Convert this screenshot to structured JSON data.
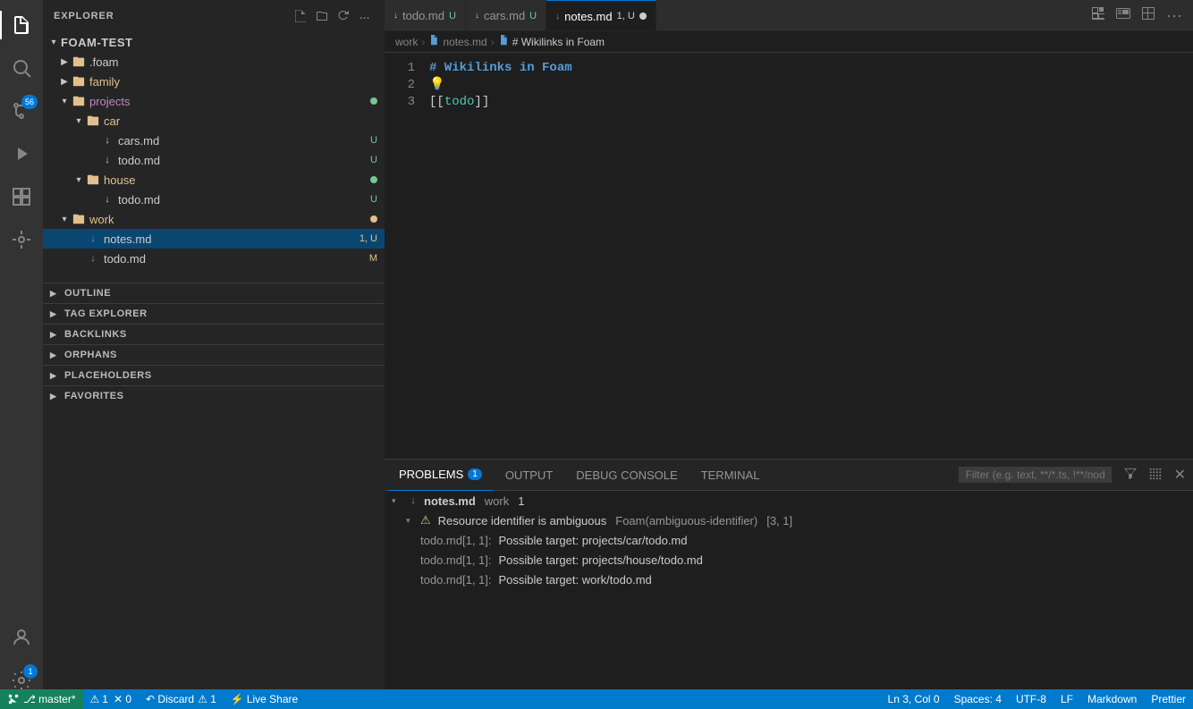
{
  "app": {
    "title": "EXPLORER"
  },
  "activity_bar": {
    "icons": [
      {
        "name": "files-icon",
        "label": "Explorer",
        "symbol": "⎘",
        "active": true,
        "badge": null
      },
      {
        "name": "search-icon",
        "label": "Search",
        "symbol": "🔍",
        "active": false,
        "badge": null
      },
      {
        "name": "source-control-icon",
        "label": "Source Control",
        "symbol": "⎇",
        "active": false,
        "badge": "56"
      },
      {
        "name": "run-icon",
        "label": "Run",
        "symbol": "▶",
        "active": false,
        "badge": null
      },
      {
        "name": "extensions-icon",
        "label": "Extensions",
        "symbol": "⧉",
        "active": false,
        "badge": null
      },
      {
        "name": "foam-icon",
        "label": "Foam",
        "symbol": "◈",
        "active": false,
        "badge": null
      }
    ],
    "bottom_icons": [
      {
        "name": "account-icon",
        "label": "Account",
        "symbol": "👤"
      },
      {
        "name": "settings-icon",
        "label": "Settings",
        "symbol": "⚙",
        "badge": "1"
      }
    ]
  },
  "sidebar": {
    "title": "EXPLORER",
    "root": "FOAM-TEST",
    "tree": [
      {
        "id": "foam-folder",
        "indent": 0,
        "type": "folder",
        "expanded": false,
        "name": ".foam",
        "badge": null,
        "dot": null
      },
      {
        "id": "family-folder",
        "indent": 0,
        "type": "folder",
        "expanded": false,
        "name": "family",
        "badge": null,
        "dot": null
      },
      {
        "id": "projects-folder",
        "indent": 0,
        "type": "folder",
        "expanded": true,
        "name": "projects",
        "badge": null,
        "dot": "green"
      },
      {
        "id": "car-folder",
        "indent": 1,
        "type": "folder",
        "expanded": true,
        "name": "car",
        "badge": null,
        "dot": null
      },
      {
        "id": "cars-md",
        "indent": 2,
        "type": "file",
        "expanded": false,
        "name": "cars.md",
        "badge": "U",
        "dot": null
      },
      {
        "id": "car-todo-md",
        "indent": 2,
        "type": "file",
        "expanded": false,
        "name": "todo.md",
        "badge": "U",
        "dot": null
      },
      {
        "id": "house-folder",
        "indent": 1,
        "type": "folder",
        "expanded": true,
        "name": "house",
        "badge": null,
        "dot": "green"
      },
      {
        "id": "house-todo-md",
        "indent": 2,
        "type": "file",
        "expanded": false,
        "name": "todo.md",
        "badge": "U",
        "dot": null
      },
      {
        "id": "work-folder",
        "indent": 0,
        "type": "folder",
        "expanded": true,
        "name": "work",
        "badge": null,
        "dot": "yellow"
      },
      {
        "id": "notes-md",
        "indent": 1,
        "type": "file",
        "expanded": false,
        "name": "notes.md",
        "badge": "1, U",
        "dot": null,
        "selected": true
      },
      {
        "id": "work-todo-md",
        "indent": 1,
        "type": "file",
        "expanded": false,
        "name": "todo.md",
        "badge": "M",
        "dot": null
      }
    ],
    "sections": [
      {
        "id": "outline",
        "label": "OUTLINE",
        "expanded": false
      },
      {
        "id": "tag-explorer",
        "label": "TAG EXPLORER",
        "expanded": false
      },
      {
        "id": "backlinks",
        "label": "BACKLINKS",
        "expanded": false
      },
      {
        "id": "orphans",
        "label": "ORPHANS",
        "expanded": false
      },
      {
        "id": "placeholders",
        "label": "PLACEHOLDERS",
        "expanded": false
      },
      {
        "id": "favorites",
        "label": "FAVORITES",
        "expanded": false
      }
    ]
  },
  "tabs": [
    {
      "id": "todo-tab",
      "name": "todo.md",
      "badge": "U",
      "active": false,
      "modified": false,
      "color": "#e2c08d"
    },
    {
      "id": "cars-tab",
      "name": "cars.md",
      "badge": "U",
      "active": false,
      "modified": false,
      "color": "#e2c08d"
    },
    {
      "id": "notes-tab",
      "name": "notes.md",
      "badge": "1, U",
      "active": true,
      "modified": true,
      "color": "#569cd6"
    }
  ],
  "breadcrumb": {
    "parts": [
      "work",
      "notes.md",
      "# Wikilinks in Foam"
    ]
  },
  "editor": {
    "lines": [
      {
        "number": "1",
        "content_type": "h1",
        "text": "# Wikilinks in Foam"
      },
      {
        "number": "2",
        "content_type": "bulb",
        "text": "💡"
      },
      {
        "number": "3",
        "content_type": "wikilink",
        "text": "[[todo]]"
      }
    ]
  },
  "panel": {
    "tabs": [
      {
        "id": "problems-tab",
        "label": "PROBLEMS",
        "count": "1",
        "active": true
      },
      {
        "id": "output-tab",
        "label": "OUTPUT",
        "count": null,
        "active": false
      },
      {
        "id": "debug-console-tab",
        "label": "DEBUG CONSOLE",
        "count": null,
        "active": false
      },
      {
        "id": "terminal-tab",
        "label": "TERMINAL",
        "count": null,
        "active": false
      }
    ],
    "filter_placeholder": "Filter (e.g. text, **/*.ts, !**/node_modules/**)",
    "entries": [
      {
        "id": "notes-entry",
        "file": "notes.md",
        "context": "work",
        "count": "1",
        "expanded": true,
        "children": [
          {
            "id": "warning-entry",
            "type": "warning",
            "message": "Resource identifier is ambiguous",
            "source": "Foam(ambiguous-identifier)",
            "position": "[3, 1]",
            "expanded": true,
            "sub_items": [
              {
                "id": "target1",
                "text": "todo.md[1, 1]: Possible target: projects/car/todo.md"
              },
              {
                "id": "target2",
                "text": "todo.md[1, 1]: Possible target: projects/house/todo.md"
              },
              {
                "id": "target3",
                "text": "todo.md[1, 1]: Possible target: work/todo.md"
              }
            ]
          }
        ]
      }
    ]
  },
  "status_bar": {
    "left": "⎇ master*",
    "warnings": "⚠ 1",
    "errors": "✕ 0",
    "discard": "↶ Discard",
    "live_share": "⚡ Live Share",
    "right_items": [
      "Ln 3, Col 0",
      "Spaces: 4",
      "UTF-8",
      "LF",
      "Markdown",
      "Prettier"
    ]
  }
}
